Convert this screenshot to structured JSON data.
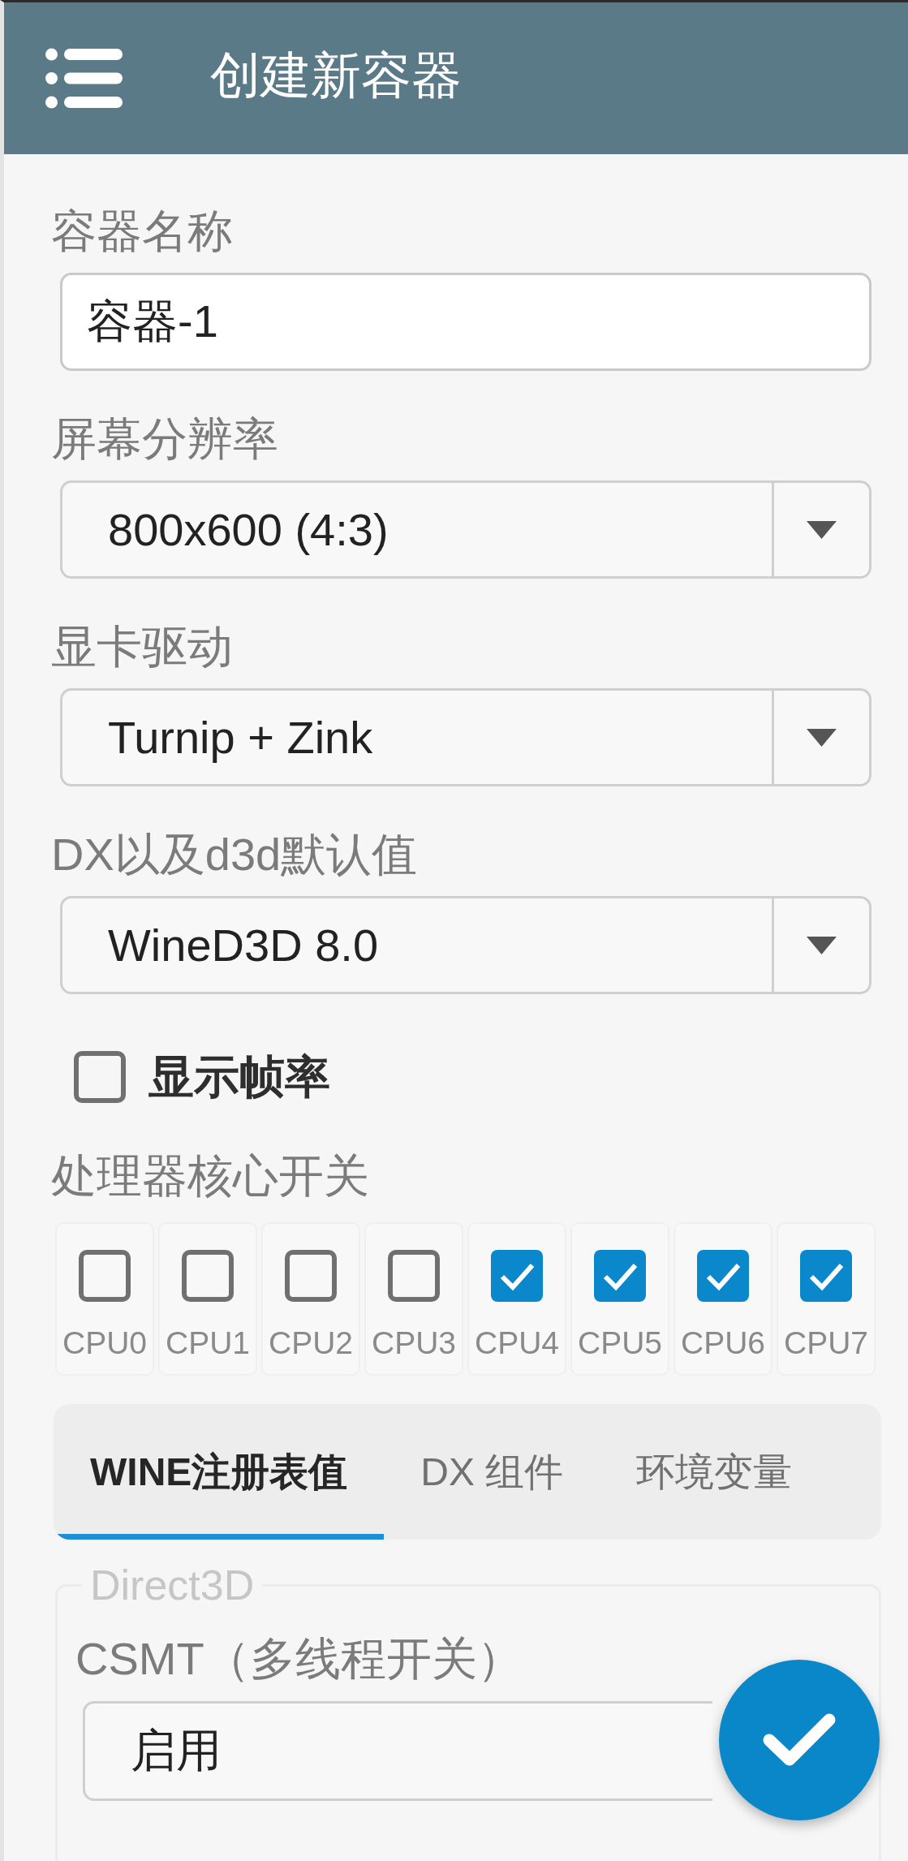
{
  "app_bar": {
    "title": "创建新容器"
  },
  "fields": [
    {
      "kind": "text",
      "label": "容器名称",
      "value": "容器-1"
    },
    {
      "kind": "dropdown",
      "label": "屏幕分辨率",
      "value": "800x600 (4:3)"
    },
    {
      "kind": "dropdown",
      "label": "显卡驱动",
      "value": "Turnip + Zink"
    },
    {
      "kind": "dropdown",
      "label": "DX以及d3d默认值",
      "value": "WineD3D 8.0"
    },
    {
      "kind": "checkbox",
      "label": "显示帧率",
      "checked": false
    }
  ],
  "cpu_cores": {
    "label": "处理器核心开关",
    "items": [
      {
        "label": "CPU0",
        "checked": false
      },
      {
        "label": "CPU1",
        "checked": false
      },
      {
        "label": "CPU2",
        "checked": false
      },
      {
        "label": "CPU3",
        "checked": false
      },
      {
        "label": "CPU4",
        "checked": true
      },
      {
        "label": "CPU5",
        "checked": true
      },
      {
        "label": "CPU6",
        "checked": true
      },
      {
        "label": "CPU7",
        "checked": true
      }
    ]
  },
  "tabs": [
    {
      "label": "WINE注册表值",
      "selected": true
    },
    {
      "label": "DX 组件",
      "selected": false
    },
    {
      "label": "环境变量",
      "selected": false
    }
  ],
  "group": {
    "title": "Direct3D",
    "items": [
      {
        "kind": "label",
        "text": "CSMT（多线程开关）"
      },
      {
        "kind": "select",
        "value": "启用"
      }
    ]
  }
}
